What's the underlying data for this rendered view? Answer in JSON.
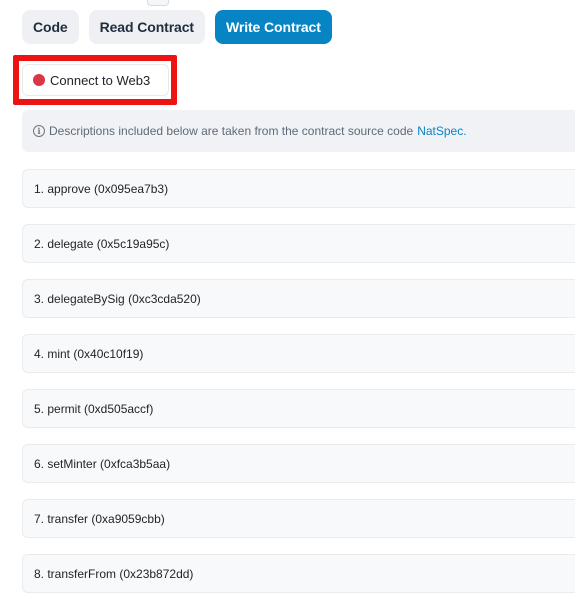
{
  "tabs": [
    {
      "label": "Code",
      "active": false
    },
    {
      "label": "Read Contract",
      "active": false
    },
    {
      "label": "Write Contract",
      "active": true
    }
  ],
  "connect": {
    "label": "Connect to Web3",
    "status_color": "#dc3545"
  },
  "highlight_color": "#ee1313",
  "info": {
    "icon": "info-circle-icon",
    "text": "Descriptions included below are taken from the contract source code",
    "link": "NatSpec."
  },
  "functions": [
    "1. approve (0x095ea7b3)",
    "2. delegate (0x5c19a95c)",
    "3. delegateBySig (0xc3cda520)",
    "4. mint (0x40c10f19)",
    "5. permit (0xd505accf)",
    "6. setMinter (0xfca3b5aa)",
    "7. transfer (0xa9059cbb)",
    "8. transferFrom (0x23b872dd)"
  ]
}
